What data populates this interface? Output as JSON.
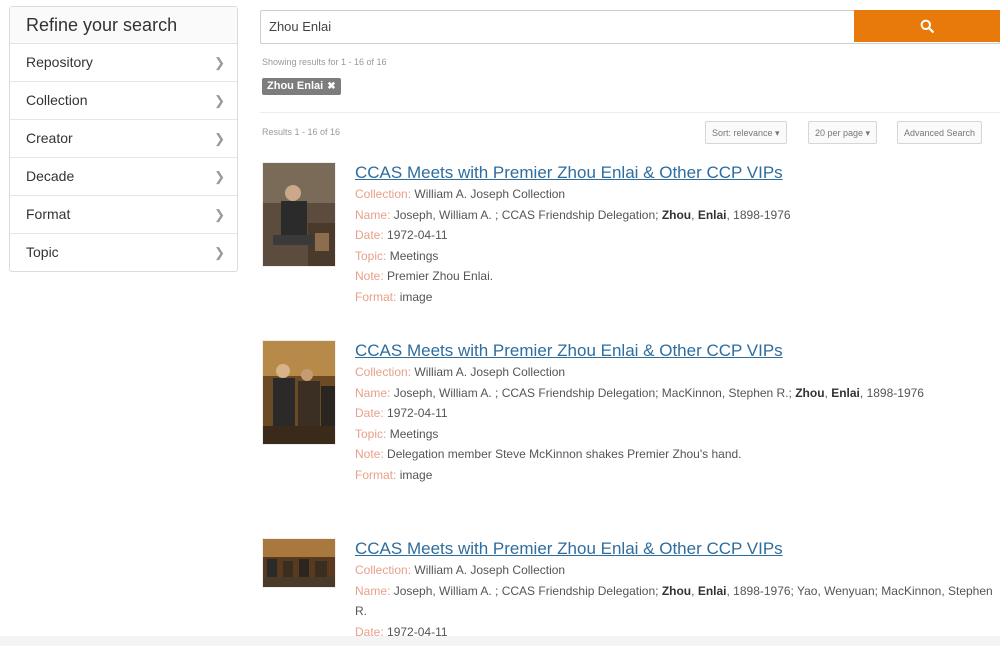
{
  "sidebar": {
    "title": "Refine your search",
    "facets": [
      {
        "label": "Repository"
      },
      {
        "label": "Collection"
      },
      {
        "label": "Creator"
      },
      {
        "label": "Decade"
      },
      {
        "label": "Format"
      },
      {
        "label": "Topic"
      }
    ]
  },
  "search": {
    "query": "Zhou Enlai",
    "button_icon": "search-icon"
  },
  "results_header": {
    "showing": "Showing results for 1 - 16 of 16",
    "chip": "Zhou Enlai",
    "count": "Results 1 - 16 of 16",
    "sort": "Sort: relevance ▾",
    "per_page": "20 per page ▾",
    "advanced": "Advanced Search"
  },
  "labels": {
    "collection": "Collection:",
    "name": "Name:",
    "date": "Date:",
    "topic": "Topic:",
    "note": "Note:",
    "format": "Format:"
  },
  "results": [
    {
      "title": "CCAS Meets with Premier Zhou Enlai & Other CCP VIPs",
      "collection": "William A. Joseph Collection",
      "name_pre": "Joseph, William A. ; CCAS Friendship Delegation; ",
      "name_bold1": "Zhou",
      "name_sep": ", ",
      "name_bold2": "Enlai",
      "name_post": ", 1898-1976",
      "date": "1972-04-11",
      "topic": "Meetings",
      "note": "Premier Zhou Enlai.",
      "format": "image"
    },
    {
      "title": "CCAS Meets with Premier Zhou Enlai & Other CCP VIPs",
      "collection": "William A. Joseph Collection",
      "name_pre": "Joseph, William A. ; CCAS Friendship Delegation; MacKinnon, Stephen R.; ",
      "name_bold1": "Zhou",
      "name_sep": ", ",
      "name_bold2": "Enlai",
      "name_post": ", 1898-1976",
      "date": "1972-04-11",
      "topic": "Meetings",
      "note": "Delegation member Steve McKinnon shakes Premier Zhou's hand.",
      "format": "image"
    },
    {
      "title": "CCAS Meets with Premier Zhou Enlai & Other CCP VIPs",
      "collection": "William A. Joseph Collection",
      "name_pre": "Joseph, William A. ; CCAS Friendship Delegation; ",
      "name_bold1": "Zhou",
      "name_sep": ", ",
      "name_bold2": "Enlai",
      "name_post": ", 1898-1976; Yao, Wenyuan; MacKinnon, Stephen R.",
      "date": "1972-04-11"
    }
  ]
}
